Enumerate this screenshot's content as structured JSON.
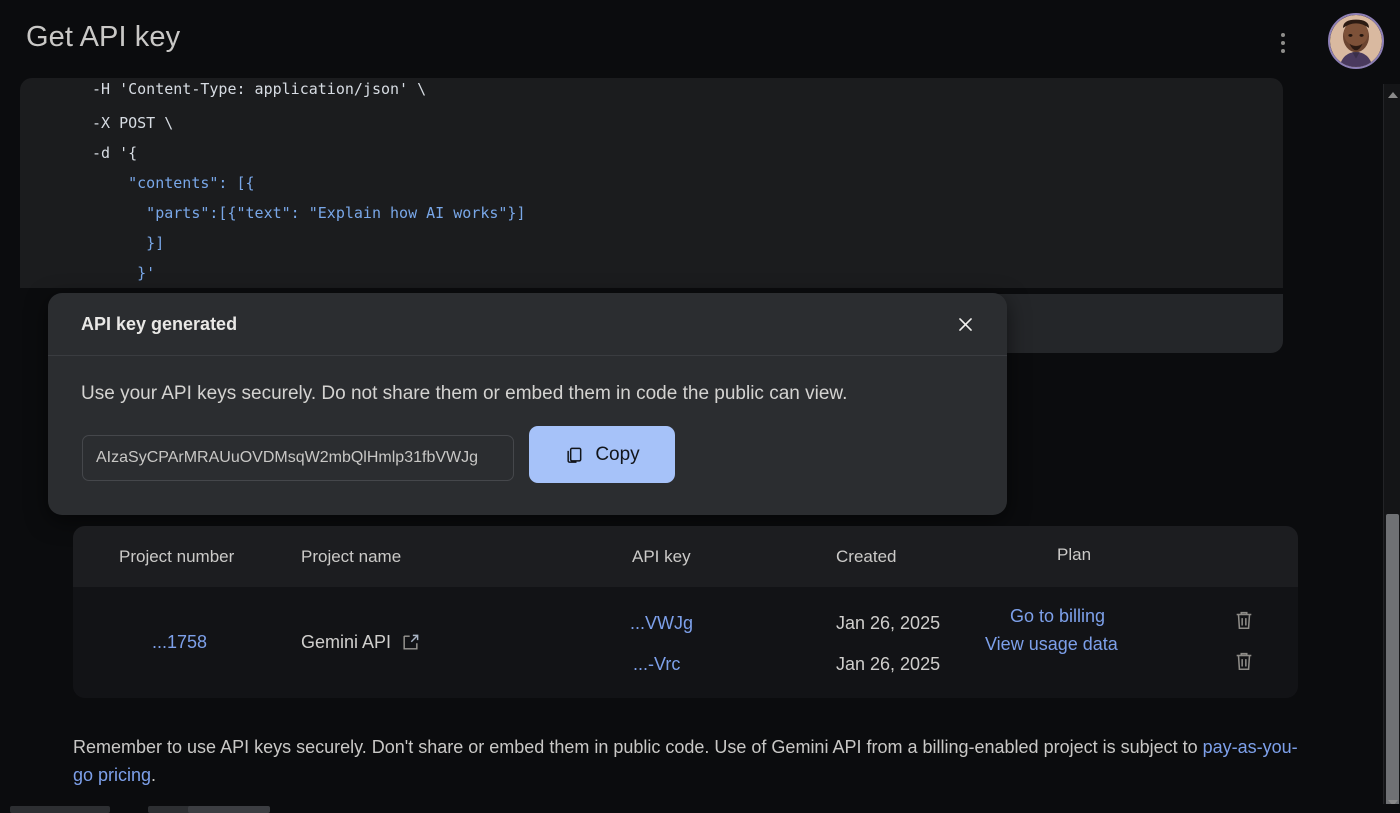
{
  "header": {
    "title": "Get API key",
    "menu_icon": "kebab-menu-icon",
    "avatar_alt": "user-avatar"
  },
  "code_block": {
    "language": "bash",
    "lines": [
      "-H 'Content-Type: application/json' \\",
      "-X POST \\",
      "-d '{",
      "    \"contents\": [{",
      "      \"parts\":[{\"text\": \"Explain how AI works\"}]",
      "      }]",
      "     }'"
    ]
  },
  "modal": {
    "title": "API key generated",
    "close_icon": "close-icon",
    "description": "Use your API keys securely. Do not share them or embed them in code the public can view.",
    "api_key_value": "AIzaSyCPArMRAUuOVDMsqW2mbQlHmlp31fbVWJg",
    "copy_label": "Copy",
    "copy_icon": "copy-icon",
    "copy_button_color": "#a6c2f9"
  },
  "table": {
    "columns": [
      "Project number",
      "Project name",
      "API key",
      "Created",
      "Plan"
    ],
    "rows": [
      {
        "project_number": "...1758",
        "project_name": "Gemini API",
        "project_link_icon": "external-link-icon",
        "api_keys": [
          "...VWJg",
          "...-Vrc"
        ],
        "created": [
          "Jan 26, 2025",
          "Jan 26, 2025"
        ],
        "plan_links": [
          "Go to billing",
          "View usage data"
        ],
        "delete_icon": "trash-icon"
      }
    ]
  },
  "footnote": {
    "text": "Remember to use API keys securely. Don't share or embed them in public code. Use of Gemini API from a billing-enabled project is subject to ",
    "link": "pay-as-you-go pricing",
    "period": "."
  },
  "colors": {
    "background": "#0b0c0e",
    "panel": "#1b1c1e",
    "modal": "#2b2d30",
    "accent_link": "#7da0ea",
    "accent_button": "#a6c2f9"
  }
}
